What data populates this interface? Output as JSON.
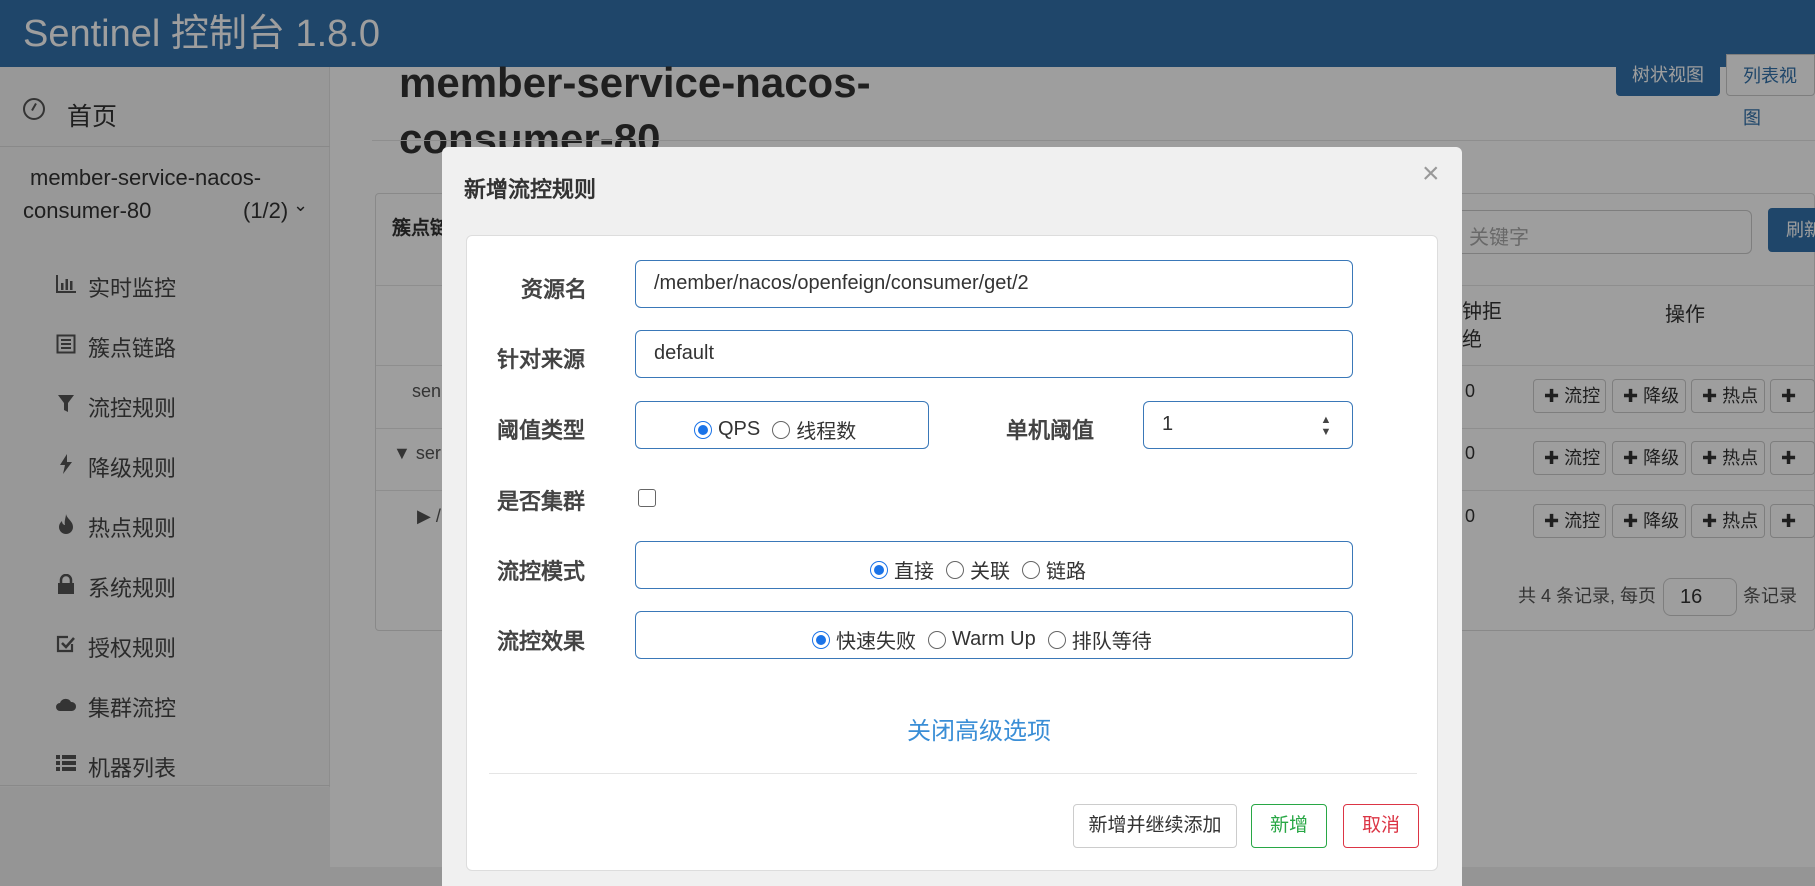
{
  "header": {
    "brand": "Sentinel 控制台 1.8.0"
  },
  "sidebar": {
    "home": "首页",
    "app_name_line1": "member-service-nacos-",
    "app_name_line2": "consumer-80",
    "app_count": "(1/2)",
    "items": [
      {
        "label": "实时监控",
        "icon": "bar-chart-icon"
      },
      {
        "label": "簇点链路",
        "icon": "list-icon"
      },
      {
        "label": "流控规则",
        "icon": "filter-icon"
      },
      {
        "label": "降级规则",
        "icon": "bolt-icon"
      },
      {
        "label": "热点规则",
        "icon": "fire-icon"
      },
      {
        "label": "系统规则",
        "icon": "lock-icon"
      },
      {
        "label": "授权规则",
        "icon": "check-square-icon"
      },
      {
        "label": "集群流控",
        "icon": "cloud-icon"
      },
      {
        "label": "机器列表",
        "icon": "th-list-icon"
      }
    ]
  },
  "main": {
    "title_line1": "member-service-nacos-",
    "title_line2": "consumer-80",
    "view_tree": "树状视图",
    "view_list": "列表视图",
    "panel_title": "簇点链",
    "search_placeholder": "关键字",
    "refresh": "刷新",
    "th_reject_1": "钟拒",
    "th_reject_2": "绝",
    "th_ops": "操作",
    "rows": [
      {
        "name": "sen",
        "zero": "0"
      },
      {
        "name": "▼ ser",
        "zero": "0"
      },
      {
        "name": "▶ /",
        "zero": "0"
      }
    ],
    "ops": [
      "✚ 流控",
      "✚ 降级",
      "✚ 热点",
      "✚ 授"
    ],
    "pager_prefix": "共 4 条记录, 每页",
    "page_size": "16",
    "pager_suffix": "条记录"
  },
  "modal": {
    "title": "新增流控规则",
    "close": "×",
    "resource_label": "资源名",
    "resource_value": "/member/nacos/openfeign/consumer/get/2",
    "origin_label": "针对来源",
    "origin_value": "default",
    "threshold_type_label": "阈值类型",
    "threshold_type_options": [
      "QPS",
      "线程数"
    ],
    "single_threshold_label": "单机阈值",
    "single_threshold_value": "1",
    "cluster_label": "是否集群",
    "mode_label": "流控模式",
    "mode_options": [
      "直接",
      "关联",
      "链路"
    ],
    "effect_label": "流控效果",
    "effect_options": [
      "快速失败",
      "Warm Up",
      "排队等待"
    ],
    "advanced_link": "关闭高级选项",
    "btn_add_continue": "新增并继续添加",
    "btn_add": "新增",
    "btn_cancel": "取消"
  },
  "colors": {
    "header": "#3272ab",
    "primary": "#1a73e8",
    "success": "#28a745",
    "danger": "#dc3545",
    "link": "#3a8ed6"
  }
}
